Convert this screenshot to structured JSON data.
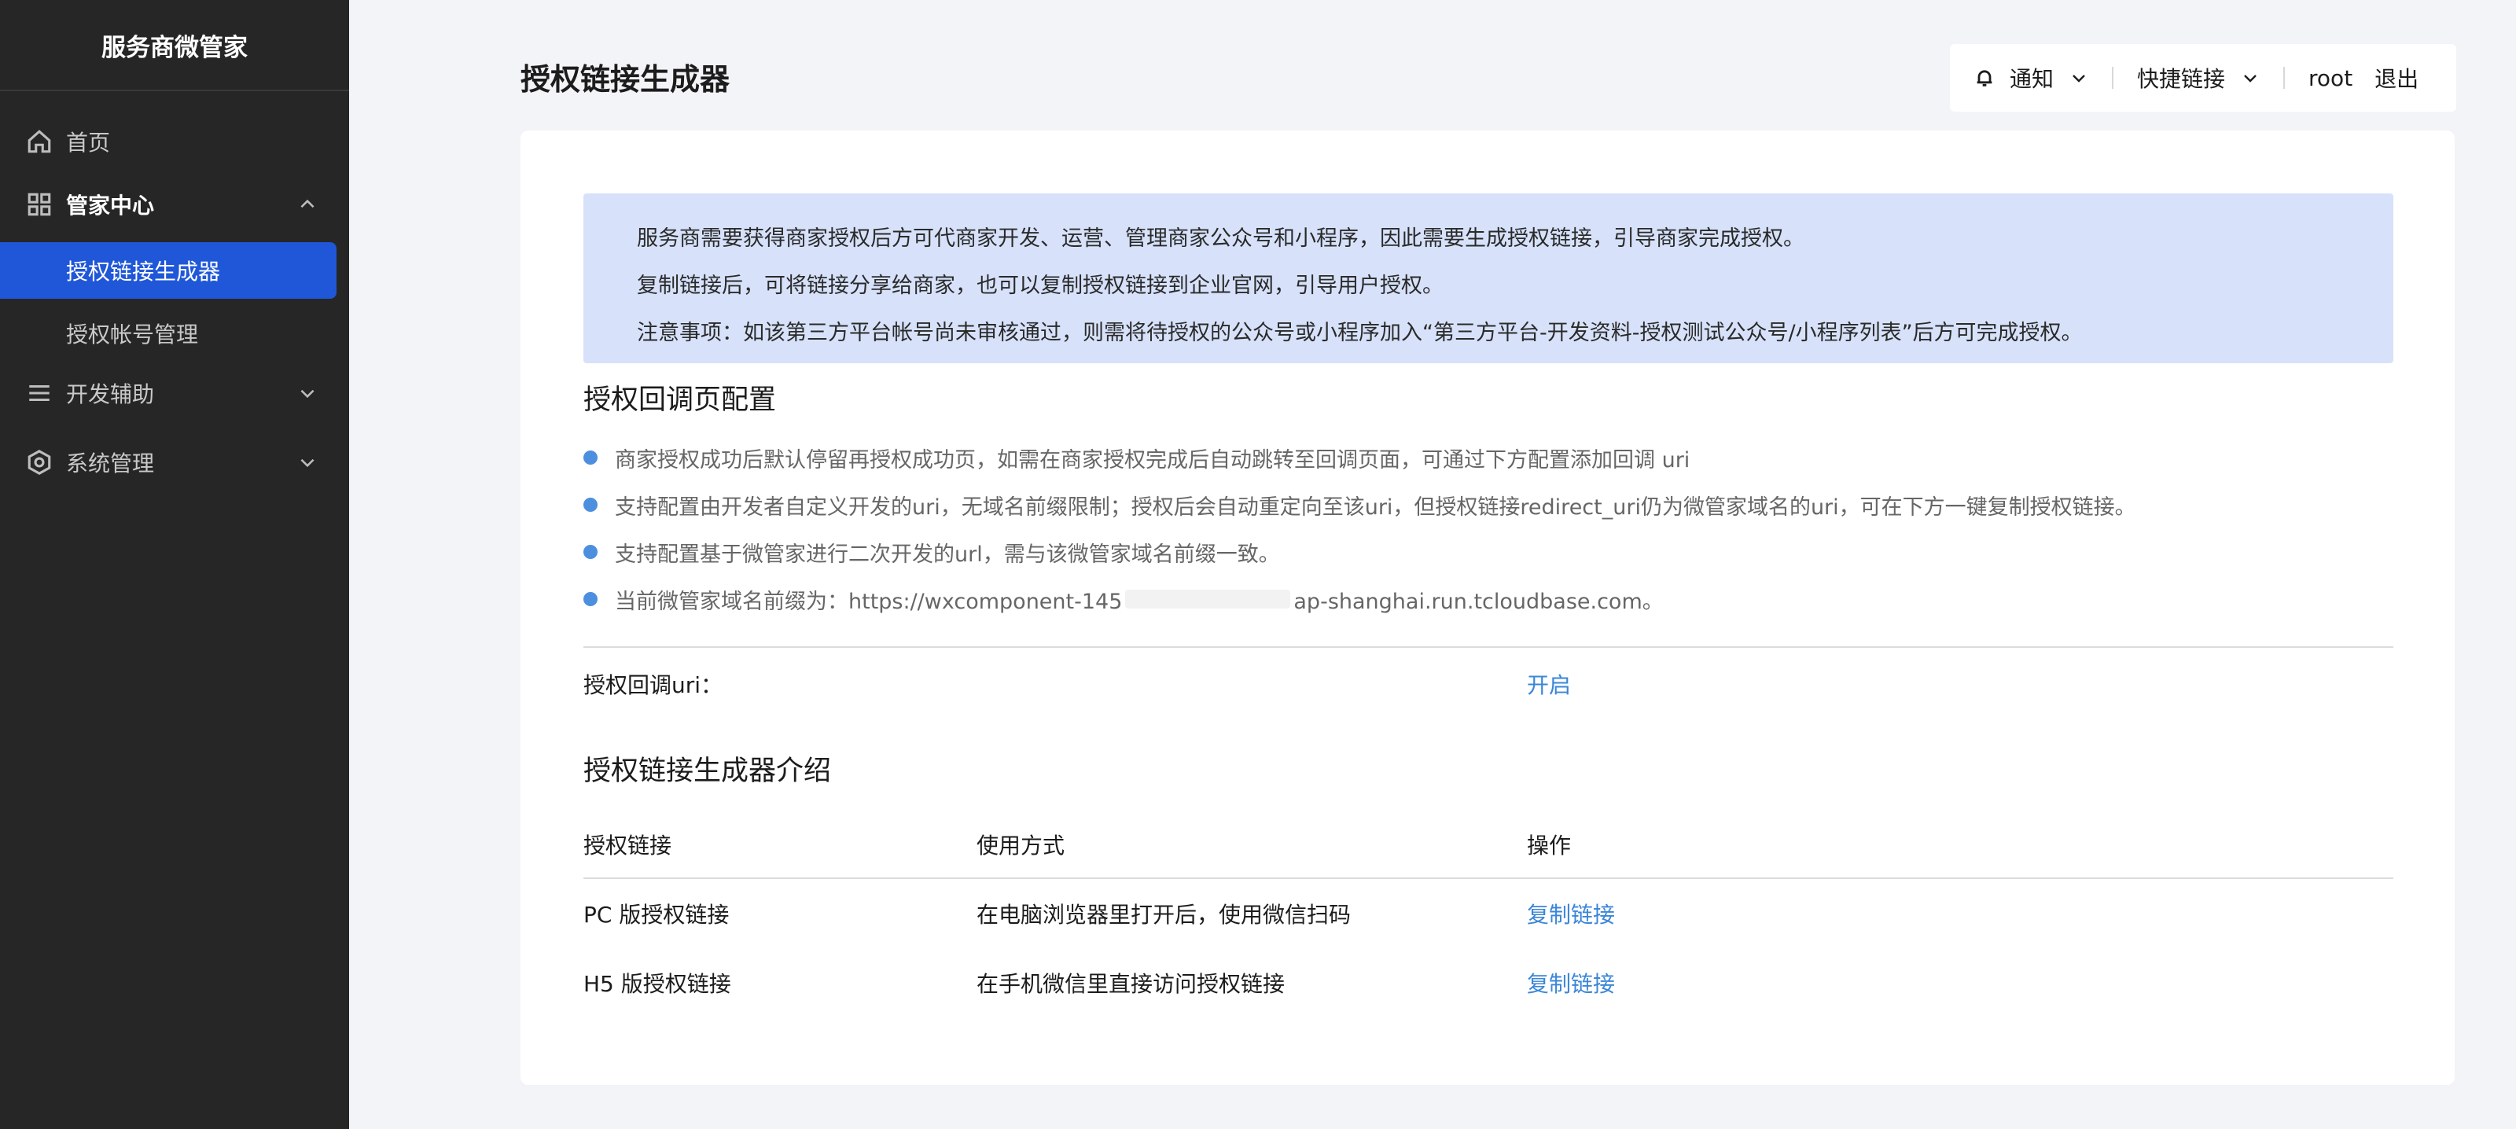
{
  "sidebar": {
    "brand": "服务商微管家",
    "home": "首页",
    "manager_center": "管家中心",
    "sub_items": [
      "授权链接生成器",
      "授权帐号管理"
    ],
    "dev_assist": "开发辅助",
    "system_manage": "系统管理"
  },
  "header": {
    "title": "授权链接生成器",
    "notify": "通知",
    "quick_links": "快捷链接",
    "user": "root",
    "logout": "退出"
  },
  "notice": {
    "lines": [
      "服务商需要获得商家授权后方可代商家开发、运营、管理商家公众号和小程序，因此需要生成授权链接，引导商家完成授权。",
      "复制链接后，可将链接分享给商家，也可以复制授权链接到企业官网，引导用户授权。",
      "注意事项：如该第三方平台帐号尚未审核通过，则需将待授权的公众号或小程序加入“第三方平台-开发资料-授权测试公众号/小程序列表”后方可完成授权。"
    ]
  },
  "callback": {
    "title": "授权回调页配置",
    "bullets": [
      "商家授权成功后默认停留再授权成功页，如需在商家授权完成后自动跳转至回调页面，可通过下方配置添加回调 uri",
      "支持配置由开发者自定义开发的uri，无域名前缀限制；授权后会自动重定向至该uri，但授权链接redirect_uri仍为微管家域名的uri，可在下方一键复制授权链接。",
      "支持配置基于微管家进行二次开发的url，需与该微管家域名前缀一致。"
    ],
    "domain_prefix_label": "当前微管家域名前缀为：https://wxcomponent-145",
    "domain_prefix_tail": "ap-shanghai.run.tcloudbase.com。",
    "uri_label": "授权回调uri：",
    "enable": "开启"
  },
  "intro": {
    "title": "授权链接生成器介绍",
    "columns": [
      "授权链接",
      "使用方式",
      "操作"
    ],
    "rows": [
      {
        "name": "PC 版授权链接",
        "usage": "在电脑浏览器里打开后，使用微信扫码",
        "action": "复制链接"
      },
      {
        "name": "H5 版授权链接",
        "usage": "在手机微信里直接访问授权链接",
        "action": "复制链接"
      }
    ]
  },
  "icons": {
    "home": "home-icon",
    "grid": "grid-icon",
    "menu": "menu-icon",
    "settings": "hexagon-gear-icon",
    "bell": "bell-icon"
  },
  "colors": {
    "sidebar_bg": "#262626",
    "active": "#1f57d8",
    "notice_bg": "#d7e2fa",
    "link": "#3b86d8"
  }
}
